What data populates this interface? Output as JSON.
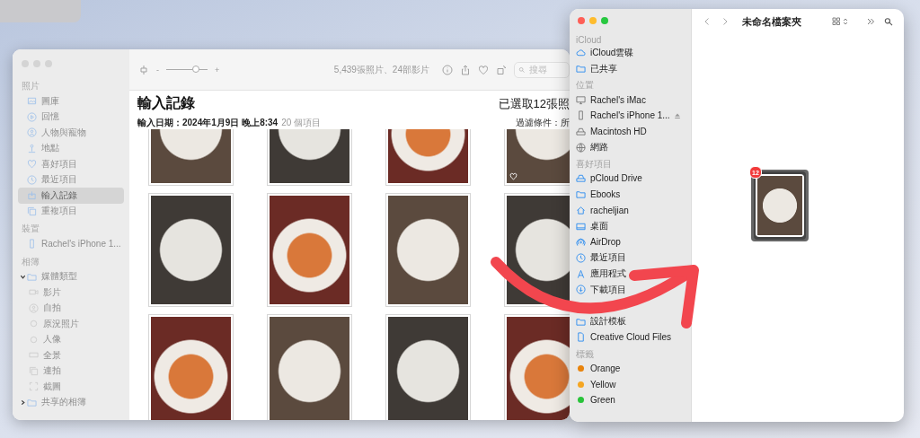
{
  "photos_window": {
    "sidebar": {
      "sections": [
        {
          "heading": "照片",
          "items": [
            {
              "label": "圖庫",
              "selected": false
            },
            {
              "label": "回憶",
              "selected": false
            },
            {
              "label": "人物與寵物",
              "selected": false
            },
            {
              "label": "地點",
              "selected": false
            },
            {
              "label": "喜好項目",
              "selected": false
            },
            {
              "label": "最近項目",
              "selected": false
            },
            {
              "label": "輸入記錄",
              "selected": true
            },
            {
              "label": "重複項目",
              "selected": false
            }
          ]
        },
        {
          "heading": "裝置",
          "items": [
            {
              "label": "Rachel's iPhone 1...",
              "selected": false
            }
          ]
        },
        {
          "heading": "相簿",
          "items": [
            {
              "label": "媒體類型",
              "selected": false,
              "expanded": true,
              "children": [
                {
                  "label": "影片",
                  "selected": false
                },
                {
                  "label": "自拍",
                  "selected": false
                },
                {
                  "label": "原況照片",
                  "selected": false
                },
                {
                  "label": "人像",
                  "selected": false
                },
                {
                  "label": "全景",
                  "selected": false
                },
                {
                  "label": "連拍",
                  "selected": false
                },
                {
                  "label": "截圖",
                  "selected": false
                }
              ]
            },
            {
              "label": "共享的相簿",
              "selected": false,
              "expanded": false
            }
          ]
        }
      ]
    },
    "toolbar": {
      "zoom_minus": "-",
      "zoom_slider": {
        "level": 0.72
      },
      "zoom_plus": "+",
      "counts": "5,439張照片、24部影片",
      "search": {
        "placeholder": "搜尋"
      }
    },
    "header": {
      "title": "輸入記錄",
      "date": "輸入日期：2024年1月9日 晚上8:34",
      "item_count": "20 個項目",
      "selection": "已選取12張照",
      "filter": "過濾條件：所"
    },
    "photos": [
      {
        "favorite": false
      },
      {
        "favorite": false
      },
      {
        "favorite": false
      },
      {
        "favorite": true
      },
      {
        "favorite": false
      },
      {
        "favorite": false
      },
      {
        "favorite": false
      },
      {
        "favorite": false
      },
      {
        "favorite": false
      },
      {
        "favorite": false
      },
      {
        "favorite": false
      },
      {
        "favorite": false
      }
    ]
  },
  "finder_window": {
    "title": "未命名檔案夾",
    "sidebar": {
      "sections": [
        {
          "heading": "iCloud",
          "items": [
            {
              "label": "iCloud雲碟"
            },
            {
              "label": "已共享"
            }
          ]
        },
        {
          "heading": "位置",
          "items": [
            {
              "label": "Rachel's iMac",
              "ejectable": false
            },
            {
              "label": "Rachel's iPhone 1...",
              "ejectable": true
            },
            {
              "label": "Macintosh HD",
              "ejectable": false
            },
            {
              "label": "網路",
              "ejectable": false
            }
          ]
        },
        {
          "heading": "喜好項目",
          "items": [
            {
              "label": "pCloud Drive"
            },
            {
              "label": "Ebooks"
            },
            {
              "label": "racheljian"
            },
            {
              "label": "桌面"
            },
            {
              "label": "AirDrop"
            },
            {
              "label": "最近項目"
            },
            {
              "label": "應用程式"
            },
            {
              "label": "下載項目"
            },
            {
              "label": "設計模板"
            },
            {
              "label": "Creative Cloud Files"
            }
          ]
        },
        {
          "heading": "標籤",
          "items": [
            {
              "label": "Orange",
              "color": "#e8830c"
            },
            {
              "label": "Yellow",
              "color": "#f5a623"
            },
            {
              "label": "Green",
              "color": "#28c33a"
            }
          ]
        }
      ]
    },
    "drag_badge": "12"
  }
}
